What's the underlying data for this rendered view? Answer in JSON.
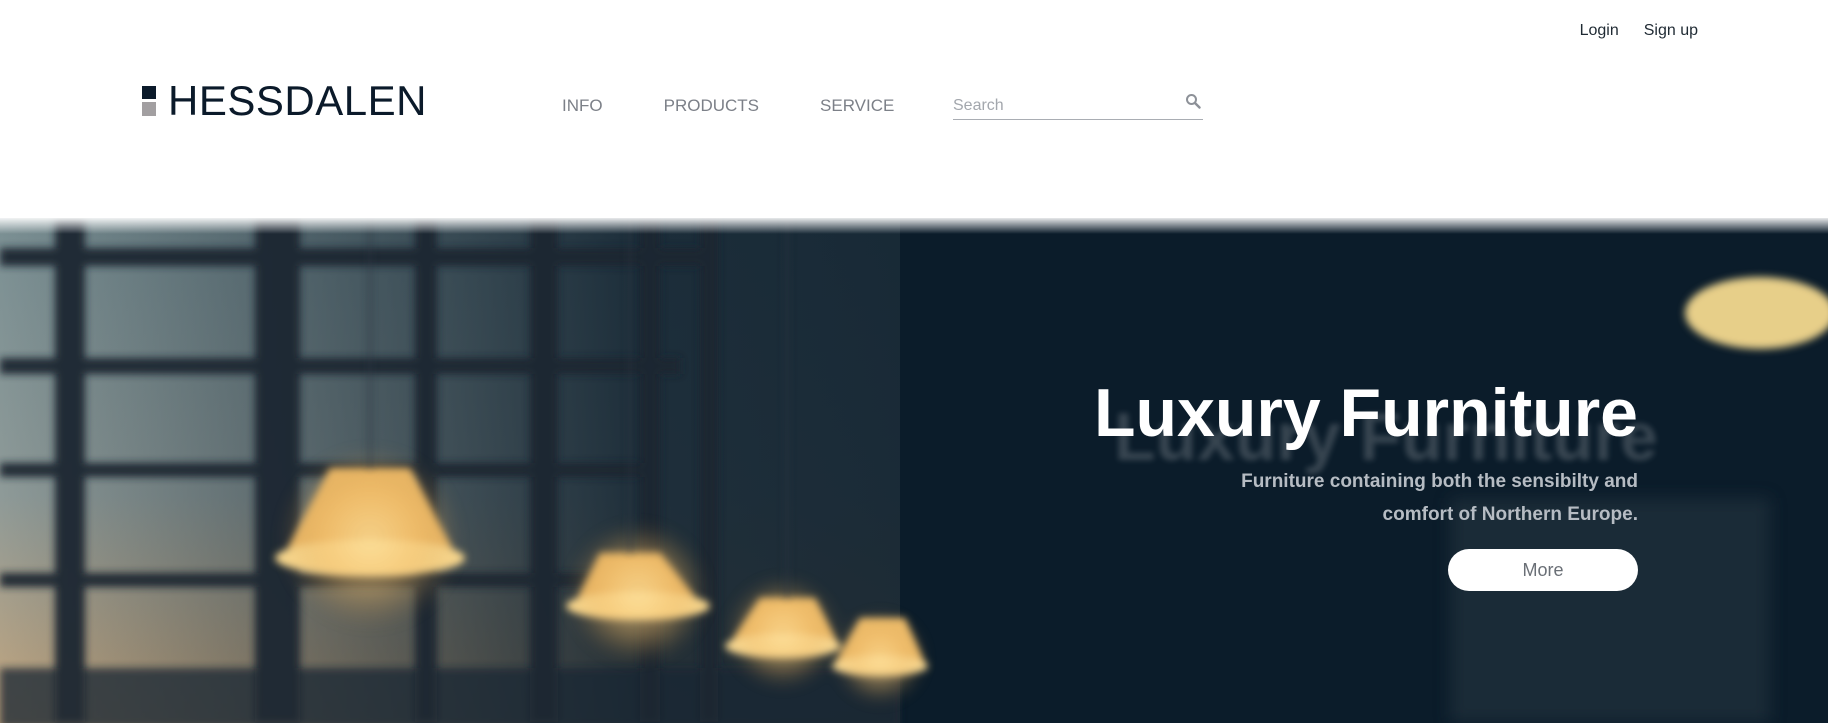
{
  "header": {
    "auth": {
      "login": "Login",
      "signup": "Sign up"
    },
    "logo": {
      "text": "HESSDALEN",
      "icon": "logo-mark-icon"
    },
    "nav": {
      "items": [
        {
          "label": "INFO"
        },
        {
          "label": "PRODUCTS"
        },
        {
          "label": "SERVICE"
        }
      ]
    },
    "search": {
      "placeholder": "Search",
      "value": "",
      "icon": "search-icon"
    }
  },
  "hero": {
    "title": "Luxury Furniture",
    "subtitle_line1": "Furniture containing both the sensibilty and",
    "subtitle_line2": "comfort of Northern Europe.",
    "button_label": "More",
    "background": "blurred-lamps-window-image"
  },
  "colors": {
    "brand_dark": "#0b1a2a",
    "brand_gray": "#a29fa1",
    "nav_text": "#7c8088",
    "hero_bg": "#0b1c2a",
    "button_bg": "#ffffff"
  }
}
